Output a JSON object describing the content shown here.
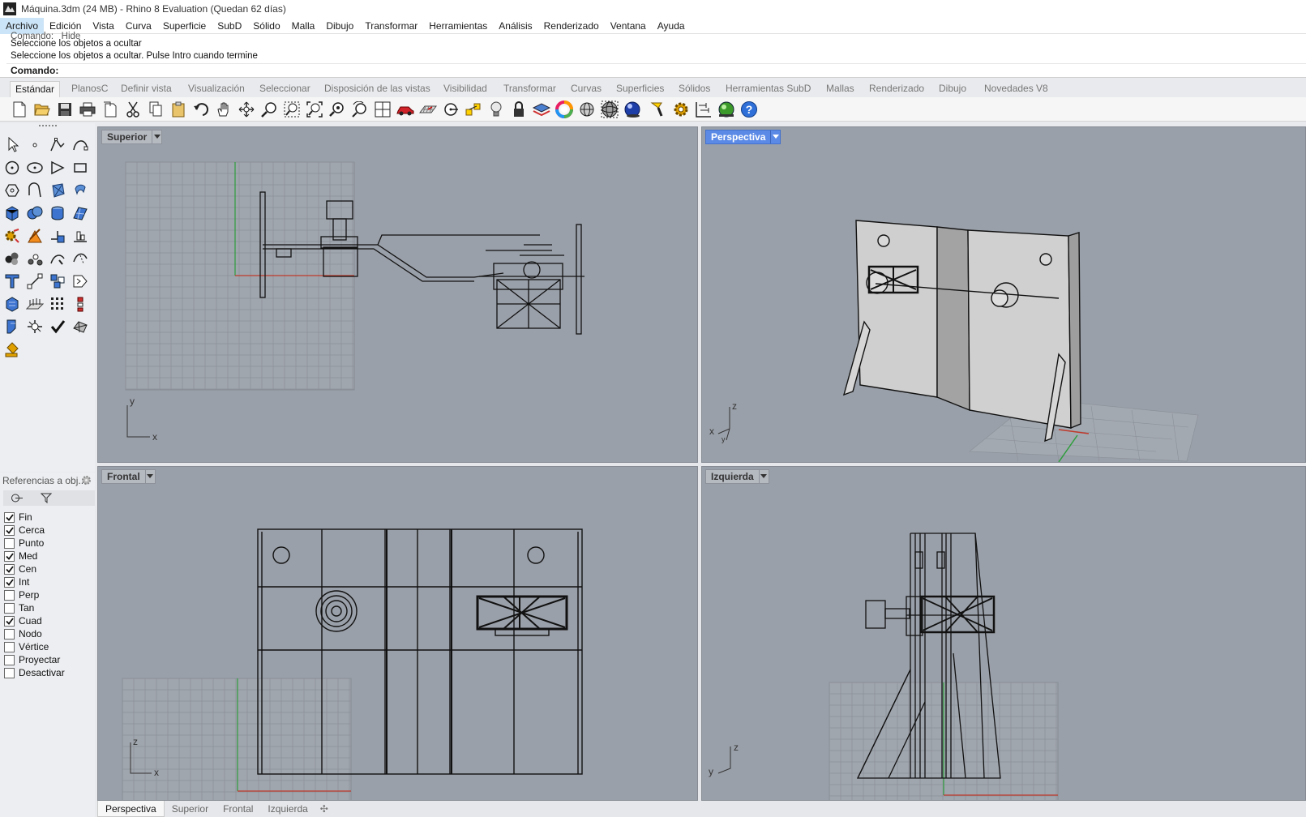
{
  "window": {
    "title": "Máquina.3dm (24 MB) - Rhino 8 Evaluation (Quedan 62 días)"
  },
  "menubar": {
    "items": [
      "Archivo",
      "Edición",
      "Vista",
      "Curva",
      "Superficie",
      "SubD",
      "Sólido",
      "Malla",
      "Dibujo",
      "Transformar",
      "Herramientas",
      "Análisis",
      "Renderizado",
      "Ventana",
      "Ayuda"
    ]
  },
  "command": {
    "history": [
      "Comando: _Hide",
      "Seleccione los objetos a ocultar",
      "Seleccione los objetos a ocultar. Pulse Intro cuando termine"
    ],
    "prompt": "Comando:",
    "value": ""
  },
  "toolbar_tabs": [
    "Estándar",
    "PlanosC",
    "Definir vista",
    "Visualización",
    "Seleccionar",
    "Disposición de las vistas",
    "Visibilidad",
    "Transformar",
    "Curvas",
    "Superficies",
    "Sólidos",
    "Herramientas SubD",
    "Mallas",
    "Renderizado",
    "Dibujo",
    "Novedades V8"
  ],
  "toolbar_icons": [
    "new-icon",
    "open-icon",
    "save-icon",
    "print-icon",
    "import-icon",
    "cut-icon",
    "copy-icon",
    "paste-icon",
    "undo-icon",
    "pan-hand-icon",
    "rotate-view-icon",
    "zoom-icon",
    "zoom-window-icon",
    "zoom-extents-icon",
    "zoom-selected-icon",
    "undo-view-icon",
    "four-viewports-icon",
    "car-icon",
    "cplane-icon",
    "snap-icon",
    "points-icon",
    "light-icon",
    "lock-icon",
    "layer-icon",
    "color-wheel-icon",
    "sphere-wire-icon",
    "sphere-shaded-icon",
    "sphere-render-icon",
    "flashlight-icon",
    "gear-icon",
    "dimension-icon",
    "render-icon",
    "help-icon"
  ],
  "osnap": {
    "title": "Referencias a obj...",
    "items": [
      {
        "label": "Fin",
        "checked": true
      },
      {
        "label": "Cerca",
        "checked": true
      },
      {
        "label": "Punto",
        "checked": false
      },
      {
        "label": "Med",
        "checked": true
      },
      {
        "label": "Cen",
        "checked": true
      },
      {
        "label": "Int",
        "checked": true
      },
      {
        "label": "Perp",
        "checked": false
      },
      {
        "label": "Tan",
        "checked": false
      },
      {
        "label": "Cuad",
        "checked": true
      },
      {
        "label": "Nodo",
        "checked": false
      },
      {
        "label": "Vértice",
        "checked": false
      },
      {
        "label": "Proyectar",
        "checked": false
      },
      {
        "label": "Desactivar",
        "checked": false
      }
    ]
  },
  "viewports": {
    "top": {
      "label": "Superior",
      "axis_a": "y",
      "axis_b": "x"
    },
    "perspective": {
      "label": "Perspectiva",
      "axis_a": "z",
      "axis_b": "x",
      "axis_c": "y"
    },
    "front": {
      "label": "Frontal",
      "axis_a": "z",
      "axis_b": "x"
    },
    "left": {
      "label": "Izquierda",
      "axis_a": "z",
      "axis_b": "y"
    }
  },
  "bottom_tabs": [
    "Perspectiva",
    "Superior",
    "Frontal",
    "Izquierda"
  ],
  "colors": {
    "viewport_bg": "#9aa0a9",
    "active_viewport_tab": "#5b8ae6",
    "grid_x_axis": "#c0392b",
    "grid_y_axis": "#2e9d3c"
  }
}
